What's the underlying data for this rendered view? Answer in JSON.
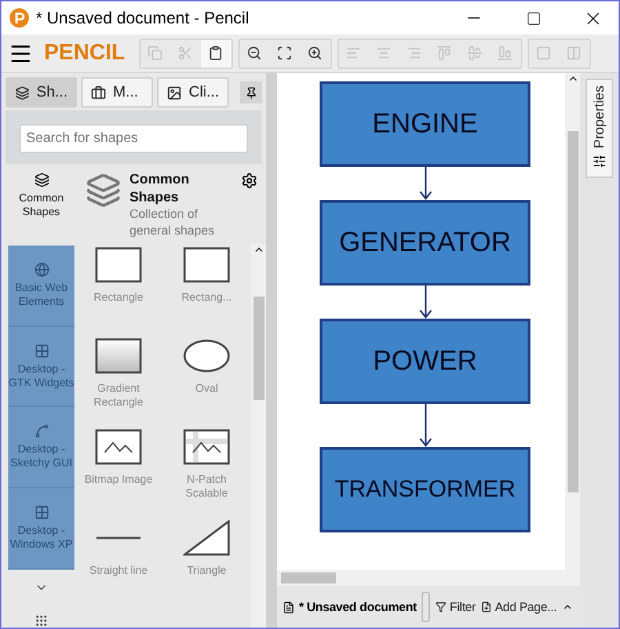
{
  "window": {
    "title": "* Unsaved document - Pencil"
  },
  "toolbar": {
    "logo": "PENCIL",
    "groups": [
      [
        {
          "kind": "copy",
          "disabled": true
        },
        {
          "kind": "cut",
          "disabled": true
        },
        {
          "kind": "paste",
          "disabled": false
        }
      ],
      [
        {
          "kind": "zoom-out",
          "disabled": false
        },
        {
          "kind": "fit",
          "disabled": false
        },
        {
          "kind": "zoom-in",
          "disabled": false
        }
      ],
      [
        {
          "kind": "align-left",
          "disabled": true
        },
        {
          "kind": "align-center",
          "disabled": true
        },
        {
          "kind": "align-right",
          "disabled": true
        },
        {
          "kind": "align-top",
          "disabled": true
        },
        {
          "kind": "align-middle",
          "disabled": true
        },
        {
          "kind": "align-bottom",
          "disabled": true
        }
      ],
      [
        {
          "kind": "same-width",
          "disabled": true
        },
        {
          "kind": "same-height",
          "disabled": true
        }
      ]
    ]
  },
  "panel_tabs": [
    {
      "label": "Sh...",
      "kind": "shapes",
      "selected": true
    },
    {
      "label": "M...",
      "kind": "briefcase",
      "selected": false
    },
    {
      "label": "Cli...",
      "kind": "image",
      "selected": false
    }
  ],
  "search": {
    "placeholder": "Search for shapes"
  },
  "collections": [
    {
      "label": "Common Shapes",
      "kind": "layers",
      "selected": true
    },
    {
      "label": "Basic Web Elements",
      "kind": "globe",
      "selected": false
    },
    {
      "label": "Desktop - GTK Widgets",
      "kind": "grid",
      "selected": false
    },
    {
      "label": "Desktop - Sketchy GUI",
      "kind": "sketch",
      "selected": false
    },
    {
      "label": "Desktop - Windows XP",
      "kind": "grid",
      "selected": false
    }
  ],
  "collection_header": {
    "title": "Common Shapes",
    "description": "Collection of general shapes"
  },
  "shapes": [
    {
      "label": "Rectangle",
      "kind": "rect"
    },
    {
      "label": "Rectang...",
      "kind": "rect"
    },
    {
      "label": "Gradient Rectangle",
      "kind": "gradient"
    },
    {
      "label": "Oval",
      "kind": "oval"
    },
    {
      "label": "Bitmap Image",
      "kind": "bitmap"
    },
    {
      "label": "N-Patch Scalable",
      "kind": "npatch"
    },
    {
      "label": "Straight line",
      "kind": "line"
    },
    {
      "label": "Triangle",
      "kind": "triangle"
    }
  ],
  "diagram": {
    "nodes": [
      {
        "label": "ENGINE"
      },
      {
        "label": "GENERATOR"
      },
      {
        "label": "POWER"
      },
      {
        "label": "TRANSFORMER"
      }
    ]
  },
  "properties_tab": {
    "label": "Properties"
  },
  "status_bar": {
    "document": "* Unsaved document",
    "filter": "Filter",
    "add_page": "Add Page..."
  }
}
